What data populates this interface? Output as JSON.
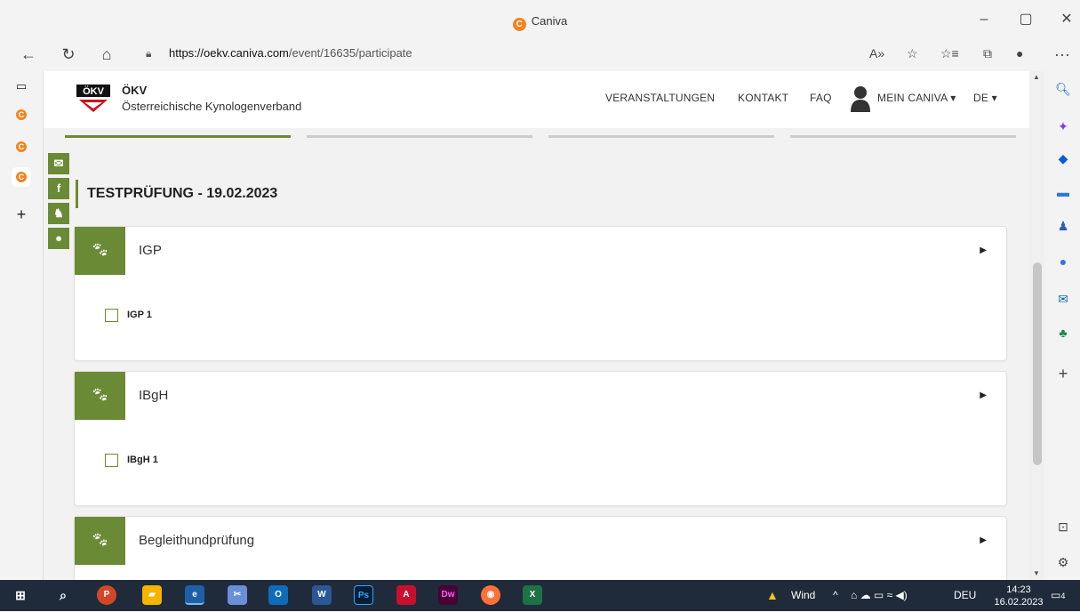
{
  "window": {
    "title": "Caniva",
    "logo_letter": "C"
  },
  "browser": {
    "url_host": "https://oekv.caniva.com",
    "url_path": "/event/16635/participate"
  },
  "site": {
    "org_short": "ÖKV",
    "org_name": "Österreichische Kynologenverband",
    "logo_text": "ÖKV",
    "menu": {
      "events": "VERANSTALTUNGEN",
      "contact": "KONTAKT",
      "faq": "FAQ",
      "account": "MEIN CANIVA",
      "language": "DE"
    },
    "brand_color": "#6b8a35"
  },
  "event": {
    "title": "TESTPRÜFUNG - 19.02.2023",
    "categories": [
      {
        "name": "IGP",
        "options": [
          "IGP 1"
        ]
      },
      {
        "name": "IBgH",
        "options": [
          "IBgH 1"
        ]
      },
      {
        "name": "Begleithundprüfung",
        "options": []
      }
    ]
  },
  "taskbar": {
    "weather": "Wind",
    "language": "DEU",
    "time": "14:23",
    "date": "16.02.2023",
    "notifications": "4"
  }
}
